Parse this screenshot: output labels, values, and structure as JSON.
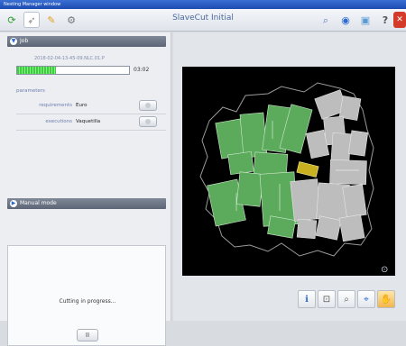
{
  "window": {
    "title": "Nesting Manager window"
  },
  "app": {
    "title": "SlaveCut Initial"
  },
  "job": {
    "header": "Job",
    "id": "2018-02-04-13-45-09.NLC.01.P",
    "progress": 0.35,
    "time": "03:02",
    "parameters_label": "parameters",
    "requirements_label": "requirements",
    "requirements_value": "Euro",
    "executions_label": "executions",
    "executions_value": "Vaquetilla"
  },
  "manual": {
    "header": "Manual mode"
  },
  "cutting": {
    "status": "Cutting in progress...",
    "pause_label": "II"
  },
  "colors": {
    "accent": "#2c6bd1",
    "cut_green": "#5cab5c",
    "pending_gray": "#bfbfbf",
    "selected": "#c8b020"
  }
}
